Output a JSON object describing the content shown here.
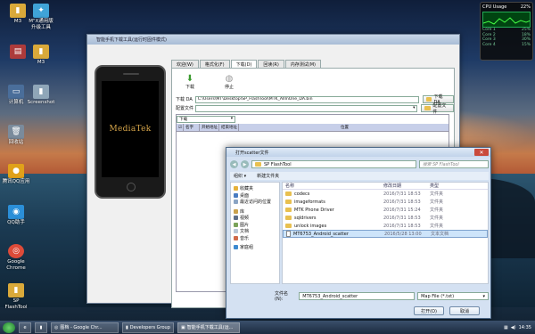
{
  "desktop": {
    "icons": [
      {
        "label": "M3",
        "color": "#d9a93a"
      },
      {
        "label": "M\"X通用版\n升级工具",
        "color": "#3fa3d7"
      },
      {
        "label": "",
        "color": "#ad3b3b"
      },
      {
        "label": "M3",
        "color": "#d9a93a"
      },
      {
        "label": "计算机",
        "color": "#4a6e9a"
      },
      {
        "label": "Screenshot",
        "color": "#8fa6b8"
      },
      {
        "label": "回收站",
        "color": "#7a8b9c"
      },
      {
        "label": "腾讯QQ应用",
        "color": "#e0a11a"
      },
      {
        "label": "QQ助手",
        "color": "#2b8fd8"
      },
      {
        "label": "Google\nChrome",
        "color": "#dd4b39"
      },
      {
        "label": "SP\nFlashTool",
        "color": "#d9a93a"
      }
    ]
  },
  "gadget": {
    "title": "CPU Usage",
    "percent": "22%",
    "rows": [
      {
        "k": "Core 1",
        "v": "25%"
      },
      {
        "k": "Core 2",
        "v": "18%"
      },
      {
        "k": "Core 3",
        "v": "30%"
      },
      {
        "k": "Core 4",
        "v": "15%"
      }
    ]
  },
  "app": {
    "title": "智能手机下载工具(运行时固件模式)",
    "brand": "MediaTek",
    "tabs": [
      "欢迎(W)",
      "格式化(F)",
      "下载(D)",
      "回读(R)",
      "内存测试(M)"
    ],
    "active_tab": "下载(D)",
    "download_label": "下载",
    "stop_label": "停止",
    "da_label": "下载 DA",
    "da_path": "C:\\Users\\MT\\Desktop\\SP_FlashTool\\MTK_AllInOne_DA.bin",
    "da_button": "下载 DA",
    "scatter_label": "配置文件",
    "scatter_button": "配置文件",
    "mode_value": "下载",
    "grid_headers": [
      "名字",
      "开始地址",
      "结束地址",
      "位置"
    ]
  },
  "dialog": {
    "title": "打开scatter文件",
    "address": "SP FlashTool",
    "search_placeholder": "搜索 SP FlashTool",
    "toolbar": {
      "organize": "组织 ▾",
      "new_folder": "新建文件夹"
    },
    "nav": {
      "favorites": "收藏夹",
      "desktop": "桌面",
      "recent": "最近访问的位置",
      "libraries": "库",
      "videos": "视频",
      "pictures": "图片",
      "documents": "文档",
      "music": "音乐",
      "homegroup": "家庭组"
    },
    "columns": [
      "名称",
      "修改日期",
      "类型"
    ],
    "files": [
      {
        "name": "codecs",
        "date": "2016/7/31 18:53",
        "type": "文件夹",
        "kind": "folder"
      },
      {
        "name": "imageformats",
        "date": "2016/7/31 18:53",
        "type": "文件夹",
        "kind": "folder"
      },
      {
        "name": "MTK Phone Driver",
        "date": "2016/7/31 15:24",
        "type": "文件夹",
        "kind": "folder"
      },
      {
        "name": "sqldrivers",
        "date": "2016/7/31 18:53",
        "type": "文件夹",
        "kind": "folder"
      },
      {
        "name": "unlock images",
        "date": "2016/7/31 18:53",
        "type": "文件夹",
        "kind": "folder"
      },
      {
        "name": "MT6753_Android_scatter",
        "date": "2016/5/28 13:00",
        "type": "文本文档",
        "kind": "text"
      }
    ],
    "filename_label": "文件名(N):",
    "filename_value": "MT6753_Android_scatter",
    "filetype_value": "Map File (*.txt)",
    "open_button": "打开(O)",
    "cancel_button": "取消"
  },
  "taskbar": {
    "items": [
      {
        "label": "图档 - Google Chr..."
      },
      {
        "label": "Developers Group"
      },
      {
        "label": "智能手机下载工具(运..."
      }
    ],
    "time": "14:35"
  }
}
